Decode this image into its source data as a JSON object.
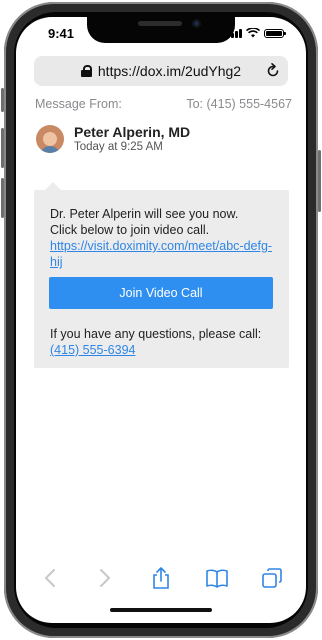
{
  "status_bar": {
    "time": "9:41"
  },
  "browser": {
    "url": "https://dox.im/2udYhg2"
  },
  "message": {
    "from_label": "Message From:",
    "to_label": "To: (415) 555-4567",
    "sender_name": "Peter Alperin, MD",
    "sent_time": "Today at 9:25 AM",
    "body_line1": "Dr. Peter Alperin will see you now.",
    "body_line2": "Click below to join video call.",
    "call_link": "https://visit.doximity.com/meet/abc-defg-hij",
    "join_button_label": "Join Video Call",
    "questions_text": "If you have any questions, please call:",
    "phone_link": "(415) 555-6394"
  },
  "toolbar": {
    "items": [
      "back-icon",
      "forward-icon",
      "share-icon",
      "bookmarks-icon",
      "tabs-icon"
    ]
  },
  "colors": {
    "accent": "#2f8ff0",
    "link": "#2f86e6",
    "card_bg": "#ececec",
    "url_bar_bg": "#e9e9ea",
    "muted_text": "#8a8a8f"
  }
}
